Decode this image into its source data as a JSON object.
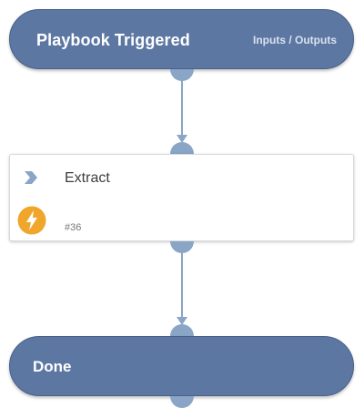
{
  "nodes": {
    "start": {
      "title": "Playbook Triggered",
      "io_link": "Inputs / Outputs"
    },
    "task": {
      "title": "Extract",
      "task_id": "#36",
      "icons": [
        "chevron-right-icon",
        "lightning-bolt-icon"
      ]
    },
    "end": {
      "title": "Done"
    }
  },
  "colors": {
    "node_fill": "#5d77a3",
    "node_border": "#4a6089",
    "port": "#8aa5c6",
    "connector": "#8aa5c6",
    "bolt_badge": "#f0a52b",
    "chevron": "#8aa5c6"
  }
}
